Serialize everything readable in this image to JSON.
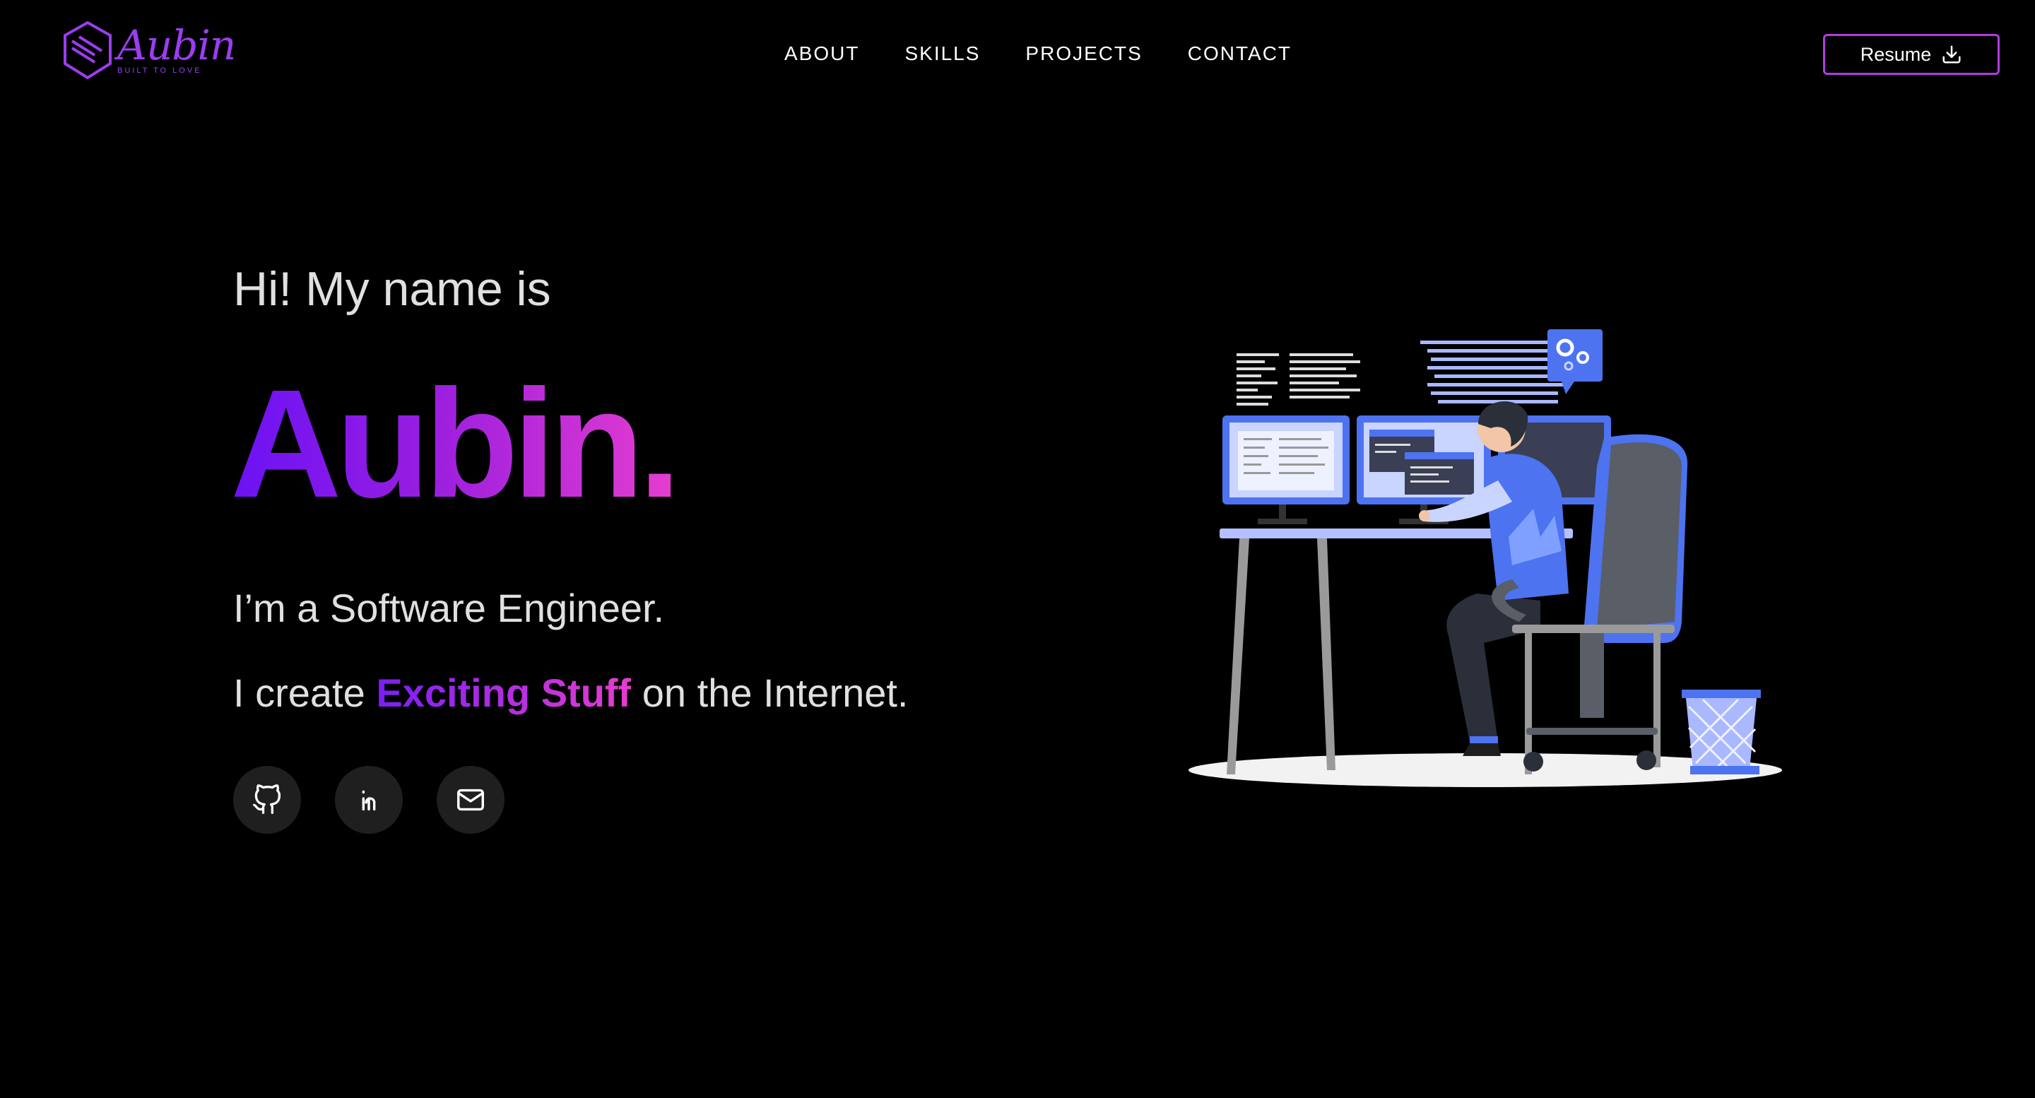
{
  "header": {
    "logo_text": "Aubin",
    "logo_tagline": "BUILT TO LOVE",
    "nav": [
      {
        "label": "ABOUT"
      },
      {
        "label": "SKILLS"
      },
      {
        "label": "PROJECTS"
      },
      {
        "label": "CONTACT"
      }
    ],
    "resume_label": "Resume"
  },
  "hero": {
    "greeting": "Hi! My name is",
    "name": "Aubin.",
    "tagline": "I’m a Software Engineer.",
    "create_prefix": "I create ",
    "create_highlight": "Exciting Stuff",
    "create_suffix": " on the Internet."
  },
  "socials": [
    {
      "icon": "github-icon"
    },
    {
      "icon": "linkedin-icon"
    },
    {
      "icon": "mail-icon"
    }
  ],
  "colors": {
    "accent_purple": "#6a12f5",
    "accent_pink": "#e63dcf",
    "background": "#000000",
    "button_border": "#b13ce0"
  }
}
